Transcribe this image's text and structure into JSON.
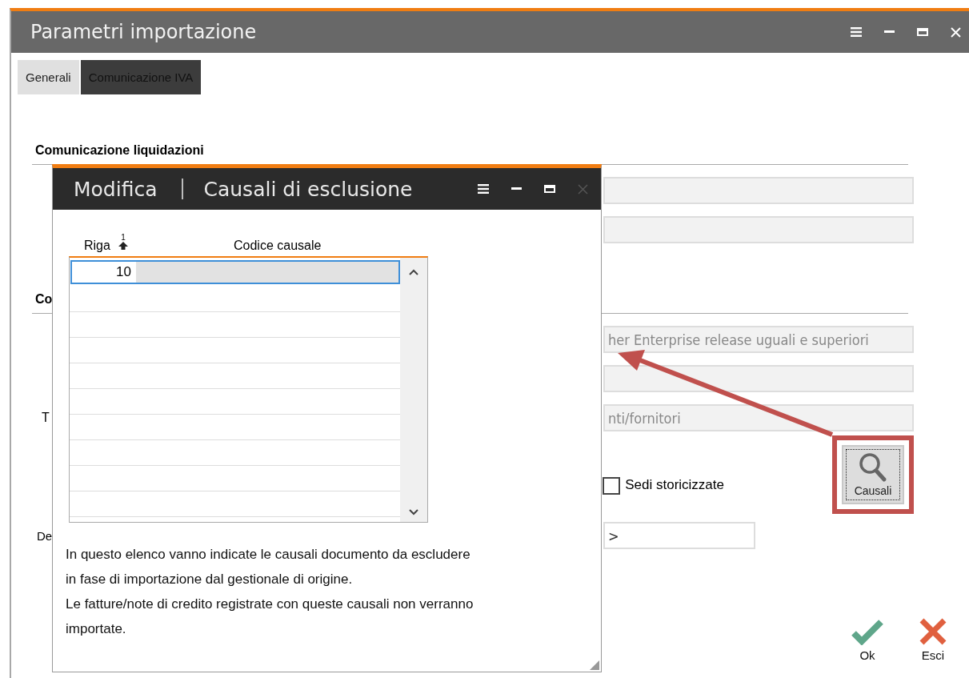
{
  "window": {
    "title": "Parametri importazione"
  },
  "tabs": [
    {
      "label": "Generali",
      "selected": false
    },
    {
      "label": "Comunicazione IVA",
      "selected": true
    }
  ],
  "rows": [
    {
      "kind": "heading",
      "text": "Comunicazione liquidazioni"
    },
    {
      "kind": "field"
    },
    {
      "kind": "field"
    },
    {
      "kind": "heading",
      "text": "Co"
    },
    {
      "kind": "field",
      "value": "her Enterprise release uguali e superiori"
    },
    {
      "kind": "field"
    },
    {
      "kind": "field",
      "label": "T",
      "value": "nti/fornitori"
    },
    {
      "kind": "checkbox",
      "label": "Sedi storicizzate",
      "checked": false,
      "button": "Causali"
    },
    {
      "kind": "short_field",
      "label": "De",
      "value": ">"
    }
  ],
  "buttons": [
    {
      "kind": "ok",
      "label": "Ok"
    },
    {
      "kind": "exit",
      "label": "Esci"
    }
  ],
  "dialog": {
    "mode": "Modifica",
    "title": "Causali di esclusione",
    "columns": [
      {
        "label": "Riga",
        "sort": "1"
      },
      {
        "label": "Codice causale"
      }
    ],
    "rows": [
      {
        "riga": "10",
        "selected": true
      }
    ],
    "note": [
      "In questo elenco vanno indicate le causali documento da escludere",
      "in fase di importazione dal gestionale di origine.",
      "Le fatture/note di credito registrate con queste causali non verranno",
      "importate."
    ]
  }
}
